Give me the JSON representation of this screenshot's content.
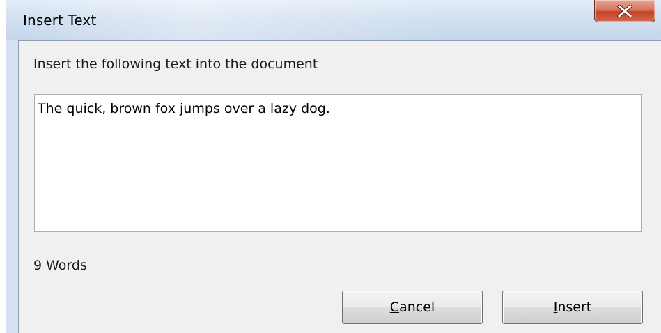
{
  "window": {
    "title": "Insert Text",
    "close_glyph": "X"
  },
  "dialog": {
    "prompt": "Insert the following text into the document",
    "text_value": "The quick, brown fox jumps over a lazy dog.",
    "word_count": "9 Words"
  },
  "buttons": {
    "cancel": {
      "accel": "C",
      "rest": "ancel"
    },
    "insert": {
      "accel": "I",
      "rest": "nsert"
    }
  },
  "colors": {
    "client_bg": "#f0f0f0",
    "close_red": "#c2452a",
    "frame_blue": "#c6d7ec"
  }
}
